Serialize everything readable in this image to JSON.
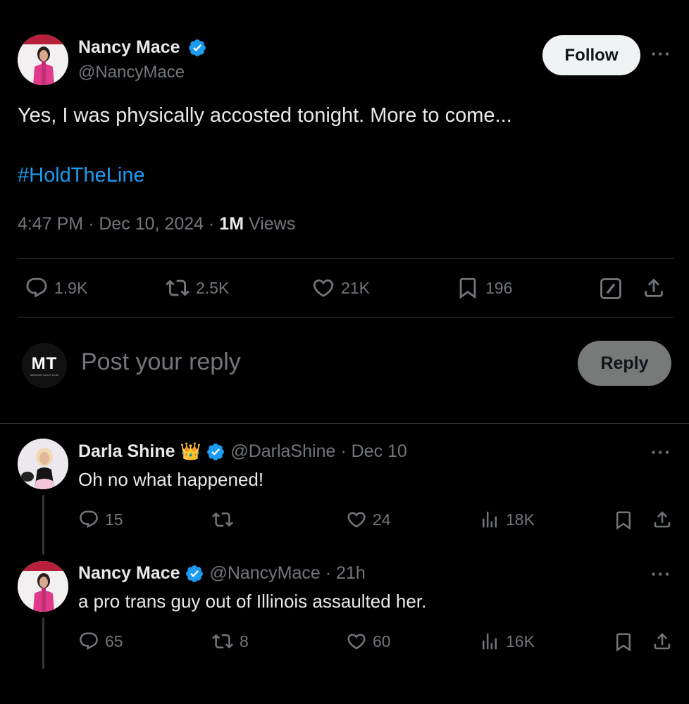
{
  "main_tweet": {
    "author_name": "Nancy Mace",
    "handle": "@NancyMace",
    "follow_label": "Follow",
    "more_label": "···",
    "text": "Yes, I was physically accosted tonight. More to come...",
    "hashtag": "#HoldTheLine",
    "time": "4:47 PM",
    "date": "Dec 10, 2024",
    "separator": "·",
    "views_count": "1M",
    "views_label": "Views",
    "stats": {
      "replies": "1.9K",
      "retweets": "2.5K",
      "likes": "21K",
      "bookmarks": "196"
    }
  },
  "reply_box": {
    "avatar_text": "MT",
    "avatar_subtext": "MEIDASTOUCH.COM",
    "placeholder": "Post your reply",
    "button_label": "Reply"
  },
  "replies": [
    {
      "author_name": "Darla Shine",
      "author_emoji": "👑",
      "handle": "@DarlaShine",
      "time": "Dec 10",
      "text": "Oh no what happened!",
      "replies": "15",
      "retweets": "",
      "likes": "24",
      "views": "18K"
    },
    {
      "author_name": "Nancy Mace",
      "author_emoji": "",
      "handle": "@NancyMace",
      "time": "21h",
      "text": "a pro trans guy out of Illinois assaulted her.",
      "replies": "65",
      "retweets": "8",
      "likes": "60",
      "views": "16K"
    }
  ],
  "colors": {
    "background": "#000000",
    "text": "#e7e9ea",
    "muted": "#71767b",
    "link": "#1d9bf0",
    "verified": "#1d9bf0",
    "divider": "#2f3336",
    "follow_bg": "#eff3f4",
    "reply_button_bg": "#787a7a"
  },
  "icons": [
    "verified-badge-icon",
    "more-icon",
    "reply-icon",
    "retweet-icon",
    "like-icon",
    "bookmark-icon",
    "grok-icon",
    "share-icon",
    "views-icon"
  ]
}
